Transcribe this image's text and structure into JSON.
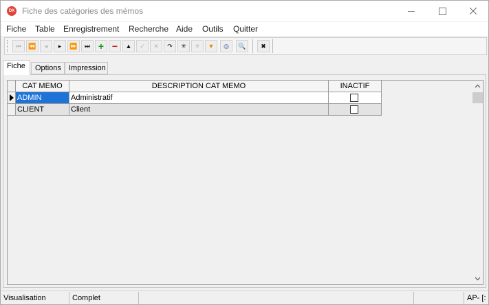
{
  "window": {
    "title": "Fiche des catégories des mémos",
    "icon_label": "DX"
  },
  "menu": {
    "items": [
      "Fiche",
      "Table",
      "Enregistrement",
      "Recherche",
      "Aide",
      "Outils",
      "Quitter"
    ]
  },
  "toolbar": {
    "buttons": [
      {
        "icon": "first-icon",
        "glyph": "⏮",
        "enabled": false
      },
      {
        "icon": "prev-page-icon",
        "glyph": "⏪",
        "enabled": false
      },
      {
        "icon": "prev-icon",
        "glyph": "◂",
        "enabled": false
      },
      {
        "icon": "next-icon",
        "glyph": "▸",
        "enabled": true
      },
      {
        "icon": "next-page-icon",
        "glyph": "⏩",
        "enabled": true
      },
      {
        "icon": "last-icon",
        "glyph": "⏭",
        "enabled": true
      },
      {
        "icon": "add-icon",
        "glyph": "+",
        "enabled": true,
        "color": "#1a9a1a"
      },
      {
        "icon": "delete-icon",
        "glyph": "−",
        "enabled": true,
        "color": "#cc1a1a"
      },
      {
        "icon": "edit-icon",
        "glyph": "▲",
        "enabled": true
      },
      {
        "icon": "post-icon",
        "glyph": "✓",
        "enabled": false
      },
      {
        "icon": "cancel-icon",
        "glyph": "✕",
        "enabled": false
      },
      {
        "icon": "refresh-icon",
        "glyph": "↷",
        "enabled": true
      },
      {
        "icon": "asterisk-icon",
        "glyph": "✳",
        "enabled": true
      },
      {
        "icon": "asterisk-disabled-icon",
        "glyph": "✳",
        "enabled": false
      },
      {
        "icon": "filter-icon",
        "glyph": "▼",
        "enabled": true,
        "color": "#e08a00"
      },
      {
        "icon": "binoculars-icon",
        "glyph": "◎",
        "enabled": true,
        "color": "#2a4a9a"
      },
      {
        "icon": "search-icon",
        "glyph": "🔍",
        "enabled": true
      },
      {
        "icon": "close-box-icon",
        "glyph": "✖",
        "enabled": true
      }
    ]
  },
  "tabs": [
    "Fiche",
    "Options",
    "Impression"
  ],
  "grid": {
    "columns": [
      "CAT MEMO",
      "DESCRIPTION CAT MEMO",
      "INACTIF"
    ],
    "rows": [
      {
        "code": "ADMIN",
        "description": "Administratif",
        "inactif": false
      },
      {
        "code": "CLIENT",
        "description": "Client",
        "inactif": false
      }
    ]
  },
  "status": {
    "mode": "Visualisation",
    "state": "Complet",
    "extra": "AP- [:"
  }
}
